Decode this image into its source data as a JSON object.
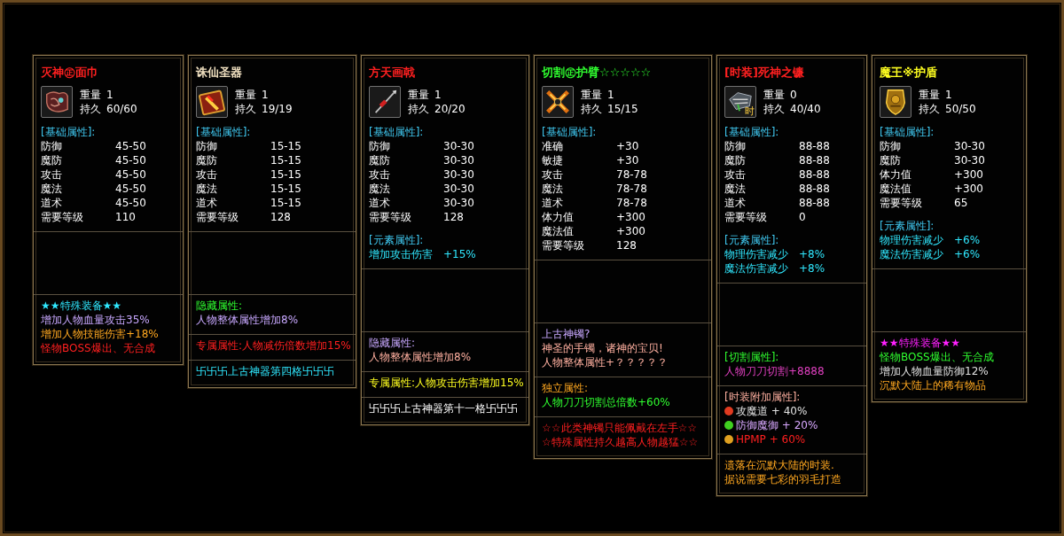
{
  "cards": [
    {
      "title": "灭神㊣面巾",
      "meta": [
        {
          "label": "重量",
          "value": "1"
        },
        {
          "label": "持久",
          "value": "60/60"
        }
      ],
      "sections": [
        {
          "kind": "stats",
          "header": "[基础属性]:",
          "rows": [
            {
              "label": "防御",
              "value": "45-50"
            },
            {
              "label": "魔防",
              "value": "45-50"
            },
            {
              "label": "攻击",
              "value": "45-50"
            },
            {
              "label": "魔法",
              "value": "45-50"
            },
            {
              "label": "道术",
              "value": "45-50"
            },
            {
              "label": "需要等级",
              "value": "110"
            }
          ]
        },
        {
          "kind": "blank"
        },
        {
          "kind": "text",
          "lines": [
            {
              "text": "★★特殊装备★★"
            },
            {
              "text": "增加人物血量攻击35%"
            },
            {
              "text": "增加人物技能伤害+18%"
            },
            {
              "text": "怪物BOSS爆出、无合成"
            }
          ]
        }
      ]
    },
    {
      "title": "诛仙圣器",
      "meta": [
        {
          "label": "重量",
          "value": "1"
        },
        {
          "label": "持久",
          "value": "19/19"
        }
      ],
      "sections": [
        {
          "kind": "stats",
          "header": "[基础属性]:",
          "rows": [
            {
              "label": "防御",
              "value": "15-15"
            },
            {
              "label": "魔防",
              "value": "15-15"
            },
            {
              "label": "攻击",
              "value": "15-15"
            },
            {
              "label": "魔法",
              "value": "15-15"
            },
            {
              "label": "道术",
              "value": "15-15"
            },
            {
              "label": "需要等级",
              "value": "128"
            }
          ]
        },
        {
          "kind": "blank"
        },
        {
          "kind": "text",
          "lines": [
            {
              "text": "隐藏属性:"
            },
            {
              "text": "人物整体属性增加8%"
            }
          ]
        },
        {
          "kind": "text",
          "lines": [
            {
              "text": "专属属性:人物减伤倍数增加15%"
            }
          ]
        },
        {
          "kind": "text",
          "lines": [
            {
              "text": "卐卐卐上古神器第四格卐卐卐"
            }
          ]
        }
      ]
    },
    {
      "title": "方天画戟",
      "meta": [
        {
          "label": "重量",
          "value": "1"
        },
        {
          "label": "持久",
          "value": "20/20"
        }
      ],
      "sections": [
        {
          "kind": "stats",
          "header": "[基础属性]:",
          "rows": [
            {
              "label": "防御",
              "value": "30-30"
            },
            {
              "label": "魔防",
              "value": "30-30"
            },
            {
              "label": "攻击",
              "value": "30-30"
            },
            {
              "label": "魔法",
              "value": "30-30"
            },
            {
              "label": "道术",
              "value": "30-30"
            },
            {
              "label": "需要等级",
              "value": "128"
            }
          ]
        },
        {
          "kind": "stats",
          "header": "[元素属性]:",
          "rows": [
            {
              "label": "增加攻击伤害",
              "value": "+15%"
            }
          ]
        },
        {
          "kind": "blank"
        },
        {
          "kind": "text",
          "lines": [
            {
              "text": "隐藏属性:"
            },
            {
              "text": "人物整体属性增加8%"
            }
          ]
        },
        {
          "kind": "text",
          "lines": [
            {
              "text": "专属属性:人物攻击伤害增加15%"
            }
          ]
        },
        {
          "kind": "text",
          "lines": [
            {
              "text": "卐卐卐上古神器第十一格卐卐卐"
            }
          ]
        }
      ]
    },
    {
      "title": "切割㊣护臂☆☆☆☆☆",
      "meta": [
        {
          "label": "重量",
          "value": "1"
        },
        {
          "label": "持久",
          "value": "15/15"
        }
      ],
      "sections": [
        {
          "kind": "stats",
          "header": "[基础属性]:",
          "rows": [
            {
              "label": "准确",
              "value": "+30"
            },
            {
              "label": "敏捷",
              "value": "+30"
            },
            {
              "label": "攻击",
              "value": "78-78"
            },
            {
              "label": "魔法",
              "value": "78-78"
            },
            {
              "label": "道术",
              "value": "78-78"
            },
            {
              "label": "体力值",
              "value": "+300"
            },
            {
              "label": "魔法值",
              "value": "+300"
            },
            {
              "label": "需要等级",
              "value": "128"
            }
          ]
        },
        {
          "kind": "blank"
        },
        {
          "kind": "text",
          "lines": [
            {
              "text": "上古神镯?"
            },
            {
              "text": "神圣的手镯，诸神的宝贝!"
            },
            {
              "text": "人物整体属性+？？？？？"
            }
          ]
        },
        {
          "kind": "text",
          "lines": [
            {
              "text": "独立属性:"
            },
            {
              "text": "人物刀刀切割总倍数+60%"
            }
          ]
        },
        {
          "kind": "text",
          "lines": [
            {
              "text": "☆☆此类神镯只能佩戴在左手☆☆"
            },
            {
              "text": "☆特殊属性持久越高人物越猛☆☆"
            }
          ]
        }
      ]
    },
    {
      "title": "[时装]死神之镰",
      "icon_badge": "时",
      "meta": [
        {
          "label": "重量",
          "value": "0"
        },
        {
          "label": "持久",
          "value": "40/40"
        }
      ],
      "sections": [
        {
          "kind": "stats",
          "header": "[基础属性]:",
          "rows": [
            {
              "label": "防御",
              "value": "88-88"
            },
            {
              "label": "魔防",
              "value": "88-88"
            },
            {
              "label": "攻击",
              "value": "88-88"
            },
            {
              "label": "魔法",
              "value": "88-88"
            },
            {
              "label": "道术",
              "value": "88-88"
            },
            {
              "label": "需要等级",
              "value": "0"
            }
          ]
        },
        {
          "kind": "stats",
          "header": "[元素属性]:",
          "rows": [
            {
              "label": "物理伤害减少",
              "value": "+8%"
            },
            {
              "label": "魔法伤害减少",
              "value": "+8%"
            }
          ]
        },
        {
          "kind": "blank"
        },
        {
          "kind": "text",
          "lines": [
            {
              "text": "[切割属性]:"
            },
            {
              "text": "人物刀刀切割+8888"
            }
          ]
        },
        {
          "kind": "text",
          "lines": [
            {
              "text": "[时装附加属性]:"
            },
            {
              "text": "攻魔道 + 40%",
              "color": "#e03a20"
            },
            {
              "text": "防御魔御 + 20%",
              "color": "#40d020"
            },
            {
              "text": "HPMP + 60%",
              "color": "#e0a020"
            }
          ]
        },
        {
          "kind": "text",
          "lines": [
            {
              "text": "遗落在沉默大陆的时装."
            },
            {
              "text": "据说需要七彩的羽毛打造"
            }
          ]
        }
      ]
    },
    {
      "title": "魔王※护盾",
      "meta": [
        {
          "label": "重量",
          "value": "1"
        },
        {
          "label": "持久",
          "value": "50/50"
        }
      ],
      "sections": [
        {
          "kind": "stats",
          "header": "[基础属性]:",
          "rows": [
            {
              "label": "防御",
              "value": "30-30"
            },
            {
              "label": "魔防",
              "value": "30-30"
            },
            {
              "label": "体力值",
              "value": "+300"
            },
            {
              "label": "魔法值",
              "value": "+300"
            },
            {
              "label": "需要等级",
              "value": "65"
            }
          ]
        },
        {
          "kind": "stats",
          "header": "[元素属性]:",
          "rows": [
            {
              "label": "物理伤害减少",
              "value": "+6%"
            },
            {
              "label": "魔法伤害减少",
              "value": "+6%"
            }
          ]
        },
        {
          "kind": "blank"
        },
        {
          "kind": "text",
          "lines": [
            {
              "text": "★★特殊装备★★"
            },
            {
              "text": "怪物BOSS爆出、无合成"
            },
            {
              "text": "增加人物血量防御12%"
            },
            {
              "text": "沉默大陆上的稀有物品"
            }
          ]
        }
      ]
    }
  ]
}
